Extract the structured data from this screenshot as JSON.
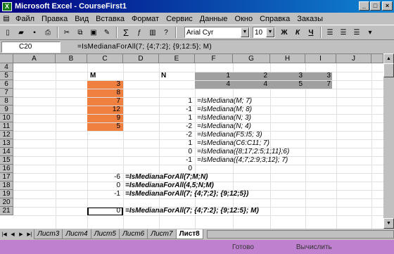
{
  "window": {
    "title": "Microsoft Excel - CourseFirst1"
  },
  "menu": [
    "Файл",
    "Правка",
    "Вид",
    "Вставка",
    "Формат",
    "Сервис",
    "Данные",
    "Окно",
    "Справка",
    "Заказы"
  ],
  "toolbar": {
    "font": "Arial Cyr",
    "size": "10",
    "bold": "Ж",
    "italic": "К",
    "underline": "Ч",
    "sum": "Σ"
  },
  "formula_bar": {
    "name_box": "C20",
    "eq": "=",
    "formula": "=IsMedianaForAll(7; {4;7:2}; {9;12:5}; M)"
  },
  "columns": [
    "A",
    "B",
    "C",
    "D",
    "E",
    "F",
    "G",
    "H",
    "I",
    "J"
  ],
  "rows": [
    "4",
    "5",
    "6",
    "7",
    "8",
    "9",
    "10",
    "11",
    "12",
    "13",
    "14",
    "15",
    "16",
    "17",
    "18",
    "19",
    "20",
    "21"
  ],
  "cells": {
    "c5": "M",
    "d5": "N",
    "f5": "1",
    "g5": "2",
    "h5": "3",
    "i5": "3",
    "f6": "4",
    "g6": "4",
    "h6": "5",
    "i6": "7",
    "c6": "3",
    "c7": "8",
    "c8": "7",
    "c9": "12",
    "c10": "9",
    "c11": "5",
    "e8": "1",
    "e9": "-1",
    "e10": "1",
    "e11": "-2",
    "e12": "-2",
    "e13": "1",
    "e14": "0",
    "e15": "-1",
    "e16": "0",
    "f8": "=IsMediana(M; 7)",
    "f9": "=IsMediana(M; 8)",
    "f10": "=IsMediana(N; 3)",
    "f11": "=IsMediana(N; 4)",
    "f12": "=IsMediana(F5:I5; 3)",
    "f13": "=IsMediana(C6:C11; 7)",
    "f14": "=IsMediana({8;17;2:5;1;11};6)",
    "f15": "=IsMediana({4;7;2:9;3;12}; 7)",
    "c17": "-6",
    "c18": "0",
    "c19": "-1",
    "c20": "0",
    "d17": "=IsMedianaForAll(7;M;N)",
    "d18": "=IsMedianaForAll(4,5;N;M)",
    "d19": "=IsMedianaForAll(7; {4;7;2}; {9;12;5})",
    "d20": "=IsMedianaForAll(7; {4;7:2}; {9;12:5}; M)"
  },
  "sheet_tabs": [
    "Лист3",
    "Лист4",
    "Лист5",
    "Лист6",
    "Лист7",
    "Лист8"
  ],
  "active_tab": "Лист8",
  "status": {
    "left": "",
    "mid": "Готово",
    "right": "Вычислить"
  },
  "colors": {
    "title": "#000080",
    "orange": "#f08040",
    "gray_block": "#a0a0a0",
    "status": "#c080d0"
  }
}
